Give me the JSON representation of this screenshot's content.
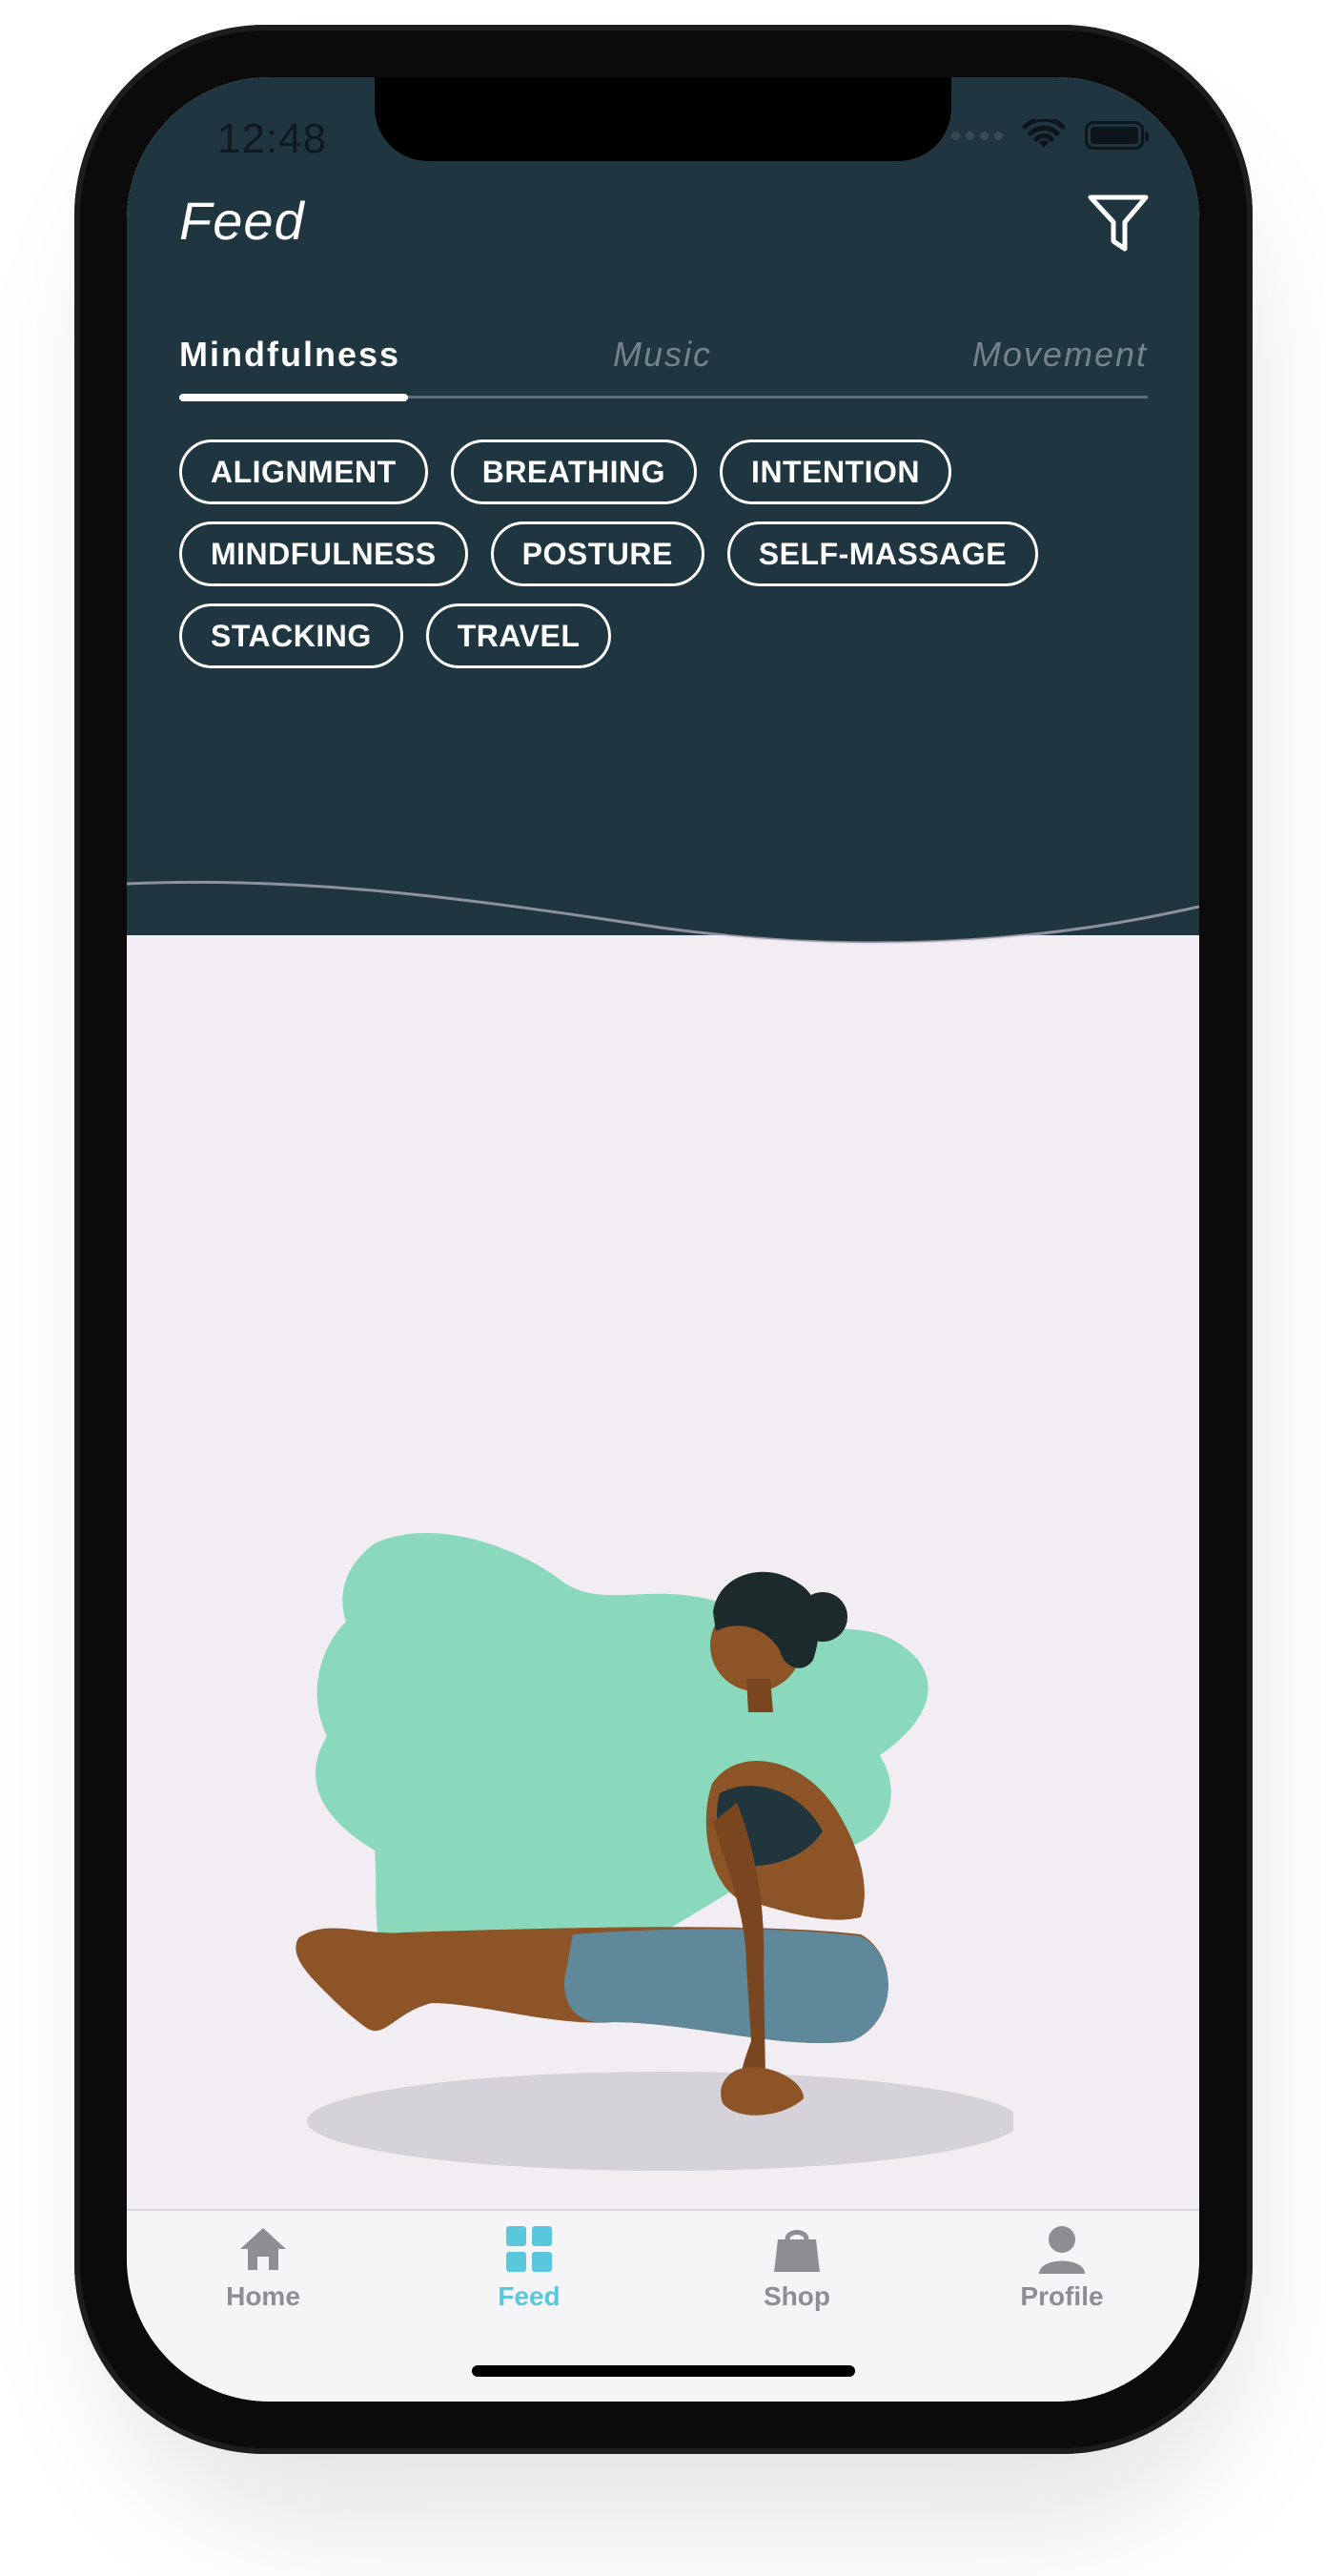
{
  "status_bar": {
    "time": "12:48"
  },
  "header": {
    "title": "Feed",
    "filter_icon": "filter-icon"
  },
  "tabs": [
    {
      "label": "Mindfulness",
      "active": true
    },
    {
      "label": "Music",
      "active": false
    },
    {
      "label": "Movement",
      "active": false
    }
  ],
  "tags": {
    "row1": [
      "ALIGNMENT",
      "BREATHING",
      "INTENTION"
    ],
    "row2": [
      "MINDFULNESS",
      "POSTURE",
      "SELF-MASSAGE"
    ],
    "row3": [
      "STACKING",
      "TRAVEL"
    ]
  },
  "tab_bar": {
    "items": [
      {
        "label": "Home",
        "icon": "home-icon",
        "active": false
      },
      {
        "label": "Feed",
        "icon": "grid-icon",
        "active": true
      },
      {
        "label": "Shop",
        "icon": "shopping-bag-icon",
        "active": false
      },
      {
        "label": "Profile",
        "icon": "person-icon",
        "active": false
      }
    ]
  },
  "colors": {
    "header_bg": "#1f3540",
    "content_bg": "#f2edf3",
    "accent": "#5ac8dc",
    "blob": "#8ad9bd"
  }
}
